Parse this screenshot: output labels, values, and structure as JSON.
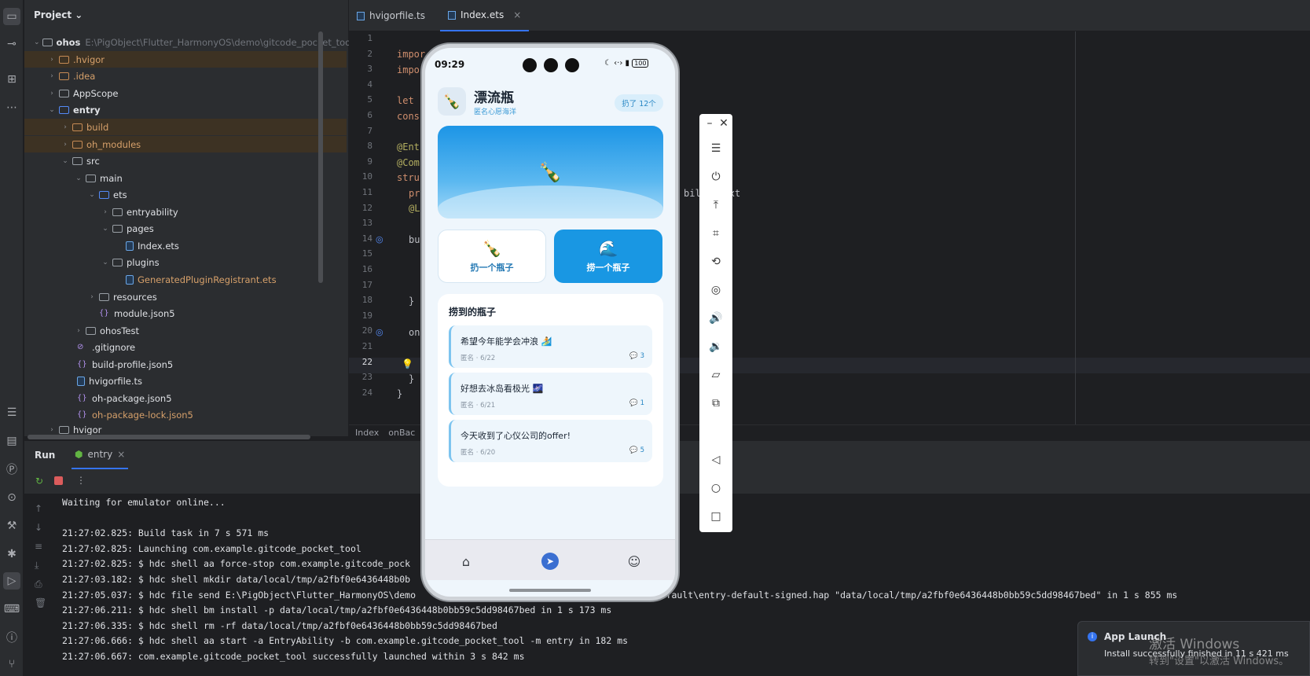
{
  "project": {
    "title": "Project",
    "root_name": "ohos",
    "root_path": "E:\\PigObject\\Flutter_HarmonyOS\\demo\\gitcode_pocket_tool\\oh",
    "items": [
      {
        "label": ".hvigor"
      },
      {
        "label": ".idea"
      },
      {
        "label": "AppScope"
      },
      {
        "label": "entry"
      },
      {
        "label": "build"
      },
      {
        "label": "oh_modules"
      },
      {
        "label": "src"
      },
      {
        "label": "main"
      },
      {
        "label": "ets"
      },
      {
        "label": "entryability"
      },
      {
        "label": "pages"
      },
      {
        "label": "Index.ets"
      },
      {
        "label": "plugins"
      },
      {
        "label": "GeneratedPluginRegistrant.ets"
      },
      {
        "label": "resources"
      },
      {
        "label": "module.json5"
      },
      {
        "label": "ohosTest"
      },
      {
        "label": ".gitignore"
      },
      {
        "label": "build-profile.json5"
      },
      {
        "label": "hvigorfile.ts"
      },
      {
        "label": "oh-package.json5"
      },
      {
        "label": "oh-package-lock.json5"
      },
      {
        "label": "hvigor"
      }
    ]
  },
  "editor": {
    "tabs": [
      {
        "label": "hvigorfile.ts"
      },
      {
        "label": "Index.ets"
      }
    ],
    "tab_close": "×",
    "line_numbers": [
      "1",
      "2",
      "3",
      "4",
      "5",
      "6",
      "7",
      "8",
      "9",
      "10",
      "11",
      "12",
      "13",
      "14",
      "15",
      "16",
      "17",
      "18",
      "19",
      "20",
      "21",
      "22",
      "23",
      "24"
    ],
    "code": {
      "l2": "impor",
      "l3": "impo",
      "l5": "let",
      "l6": "cons",
      "l8": "@Ent",
      "l9": "@Com",
      "l10": "stru",
      "l11": "pr",
      "l11_tail": "bili   ext",
      "l12": "@L",
      "l14": "bui",
      "l18": "}",
      "l20": "on",
      "l23": "}",
      "l24": "}"
    },
    "breadcrumb": [
      "Index",
      "onBac"
    ]
  },
  "run": {
    "title": "Run",
    "config": "entry",
    "logs": [
      "Waiting for emulator online...",
      "",
      "21:27:02.825: Build task in 7 s 571 ms",
      "21:27:02.825: Launching com.example.gitcode_pocket_tool",
      "21:27:02.825: $ hdc shell aa force-stop com.example.gitcode_pock",
      "21:27:03.182: $ hdc shell mkdir data/local/tmp/a2fbf0e6436448b0b",
      "21:27:05.037: $ hdc file send E:\\PigObject\\Flutter_HarmonyOS\\demo                                 lt\\outputs\\default\\entry-default-signed.hap \"data/local/tmp/a2fbf0e6436448b0bb59c5dd98467bed\" in 1 s 855 ms",
      "21:27:06.211: $ hdc shell bm install -p data/local/tmp/a2fbf0e6436448b0bb59c5dd98467bed in 1 s 173 ms",
      "21:27:06.335: $ hdc shell rm -rf data/local/tmp/a2fbf0e6436448b0bb59c5dd98467bed",
      "21:27:06.666: $ hdc shell aa start -a EntryAbility -b com.example.gitcode_pocket_tool -m entry in 182 ms",
      "21:27:06.667: com.example.gitcode_pocket_tool successfully launched within 3 s 842 ms"
    ]
  },
  "toast": {
    "title": "App Launch",
    "message": "Install successfully finished in 11 s 421 ms"
  },
  "watermark": {
    "line1": "激活 Windows",
    "line2": "转到\"设置\"以激活 Windows。"
  },
  "phone": {
    "status": {
      "time": "09:29",
      "battery": "100"
    },
    "header": {
      "icon": "🍾",
      "title": "漂流瓶",
      "subtitle": "匿名心愿海洋",
      "badge": "扔了 12个"
    },
    "hero_icon": "🍾",
    "actions": [
      {
        "icon": "🍾",
        "label": "扔一个瓶子"
      },
      {
        "icon": "🌊",
        "label": "捞一个瓶子"
      }
    ],
    "list_title": "捞到的瓶子",
    "bottles": [
      {
        "text": "希望今年能学会冲浪 🏄",
        "meta": "匿名 · 6/22",
        "count": "3"
      },
      {
        "text": "好想去冰岛看极光 🌌",
        "meta": "匿名 · 6/21",
        "count": "1"
      },
      {
        "text": "今天收到了心仪公司的offer!",
        "meta": "匿名 · 6/20",
        "count": "5"
      }
    ],
    "tabbar": [
      "home-icon",
      "compass-icon",
      "user-icon"
    ]
  },
  "emulator_toolbar": [
    "minimize",
    "close",
    "menu",
    "power",
    "upload",
    "crop",
    "rotate",
    "screenshot",
    "volume-up",
    "volume-down",
    "fold",
    "multi-screen",
    "back",
    "home",
    "overview"
  ]
}
